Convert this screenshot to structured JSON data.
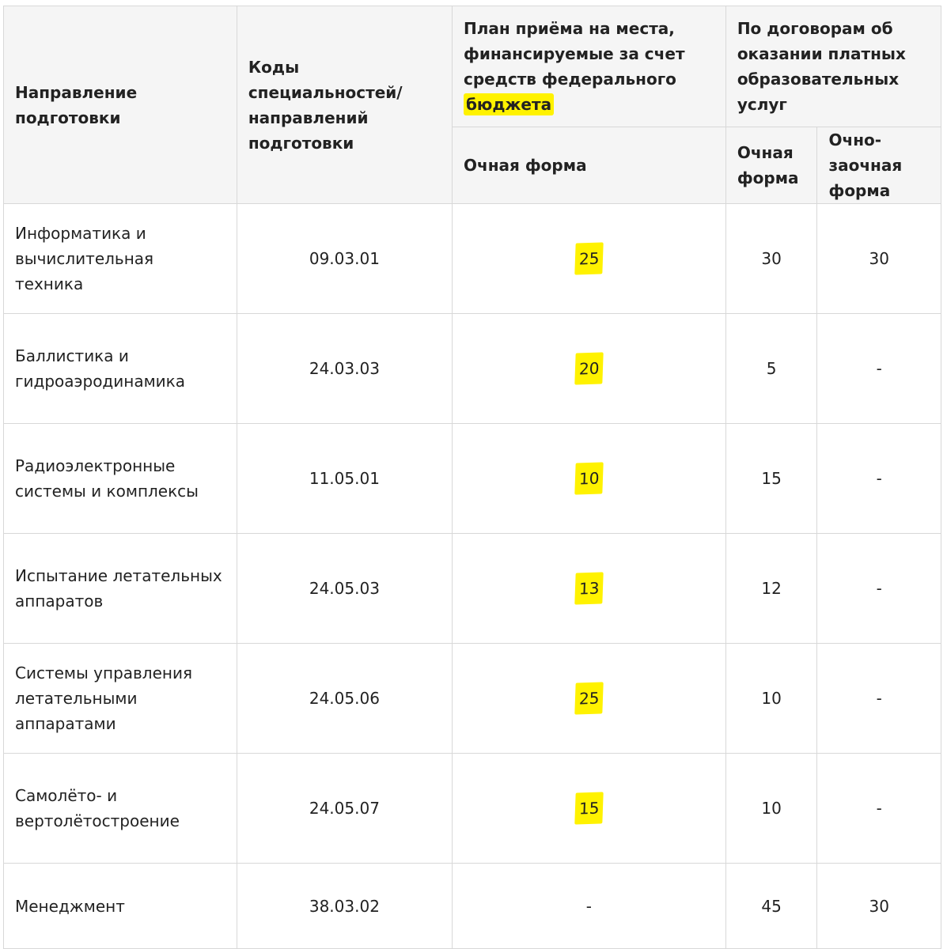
{
  "header": {
    "direction": "Направление подготовки",
    "codes": "Коды специальностей/ направлений подготовки",
    "budget_plan_before": "План приёма на места, финансируемые за счет средств федерального",
    "budget_plan_highlight": "бюджета",
    "paid": "По договорам об оказании платных образовательных услуг",
    "budget_fulltime": "Очная форма",
    "paid_fulltime": "Очная форма",
    "paid_parttime": "Очно-заочная форма"
  },
  "rows": [
    {
      "direction": "Информатика и вычислительная техника",
      "code": "09.03.01",
      "budget": "25",
      "paid_fulltime": "30",
      "paid_parttime": "30"
    },
    {
      "direction": "Баллистика и гидроаэродинамика",
      "code": "24.03.03",
      "budget": "20",
      "paid_fulltime": "5",
      "paid_parttime": "-"
    },
    {
      "direction": "Радиоэлектронные системы и комплексы",
      "code": "11.05.01",
      "budget": "10",
      "paid_fulltime": "15",
      "paid_parttime": "-"
    },
    {
      "direction": "Испытание летательных аппаратов",
      "code": "24.05.03",
      "budget": "13",
      "paid_fulltime": "12",
      "paid_parttime": "-"
    },
    {
      "direction": "Системы управления летательными аппаратами",
      "code": "24.05.06",
      "budget": "25",
      "paid_fulltime": "10",
      "paid_parttime": "-"
    },
    {
      "direction": "Самолёто- и вертолётостроение",
      "code": "24.05.07",
      "budget": "15",
      "paid_fulltime": "10",
      "paid_parttime": "-"
    },
    {
      "direction": "Менеджмент",
      "code": "38.03.02",
      "budget": "-",
      "paid_fulltime": "45",
      "paid_parttime": "30"
    }
  ],
  "highlight_color": "#fff200"
}
